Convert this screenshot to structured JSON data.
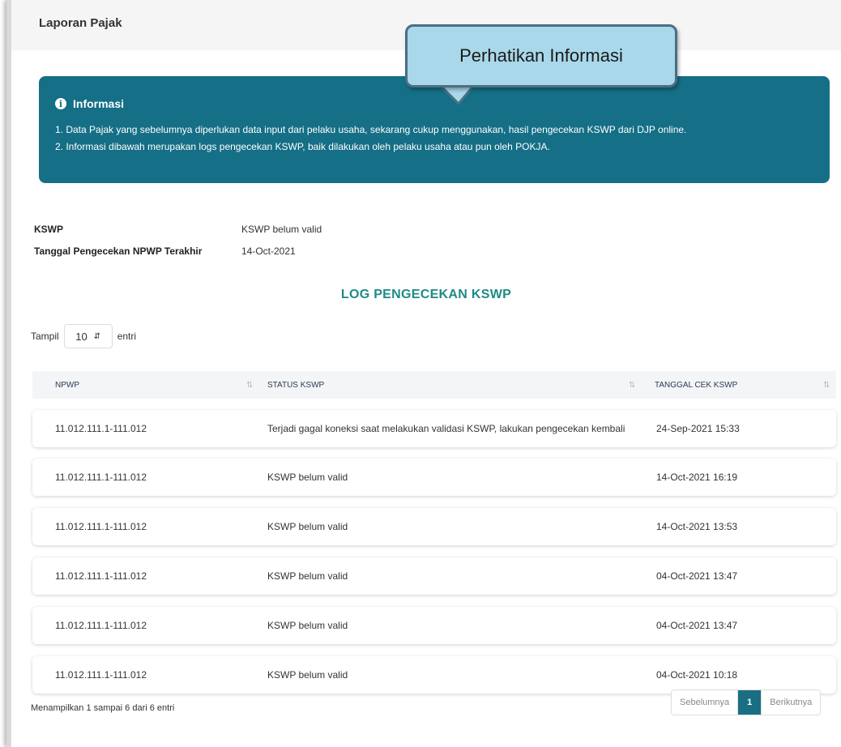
{
  "page": {
    "title": "Laporan Pajak"
  },
  "callout": {
    "text": "Perhatikan Informasi"
  },
  "info": {
    "heading": "Informasi",
    "lines": [
      "1. Data Pajak yang sebelumnya diperlukan data input dari pelaku usaha, sekarang cukup menggunakan, hasil pengecekan KSWP dari DJP online.",
      "2. Informasi dibawah merupakan logs pengecekan KSWP, baik dilakukan oleh pelaku usaha atau pun oleh POKJA."
    ]
  },
  "details": [
    {
      "label": "KSWP",
      "value": "KSWP belum valid"
    },
    {
      "label": "Tanggal Pengecekan NPWP Terakhir",
      "value": "14-Oct-2021"
    }
  ],
  "log": {
    "title": "LOG PENGECEKAN KSWP",
    "length_prefix": "Tampil",
    "length_value": "10",
    "length_suffix": "entri",
    "columns": [
      "NPWP",
      "STATUS KSWP",
      "TANGGAL CEK KSWP"
    ],
    "rows": [
      [
        "11.012.111.1-111.012",
        "Terjadi gagal koneksi saat melakukan validasi KSWP, lakukan pengecekan kembali",
        "24-Sep-2021 15:33"
      ],
      [
        "11.012.111.1-111.012",
        "KSWP belum valid",
        "14-Oct-2021 16:19"
      ],
      [
        "11.012.111.1-111.012",
        "KSWP belum valid",
        "14-Oct-2021 13:53"
      ],
      [
        "11.012.111.1-111.012",
        "KSWP belum valid",
        "04-Oct-2021 13:47"
      ],
      [
        "11.012.111.1-111.012",
        "KSWP belum valid",
        "04-Oct-2021 13:47"
      ],
      [
        "11.012.111.1-111.012",
        "KSWP belum valid",
        "04-Oct-2021 10:18"
      ]
    ],
    "footer_info": "Menampilkan 1 sampai 6 dari 6 entri",
    "pager": {
      "prev": "Sebelumnya",
      "current": "1",
      "next": "Berikutnya"
    }
  },
  "colors": {
    "info_bg": "#156f86",
    "accent_title": "#1f8a86",
    "callout_bg": "#a9d8ea"
  }
}
